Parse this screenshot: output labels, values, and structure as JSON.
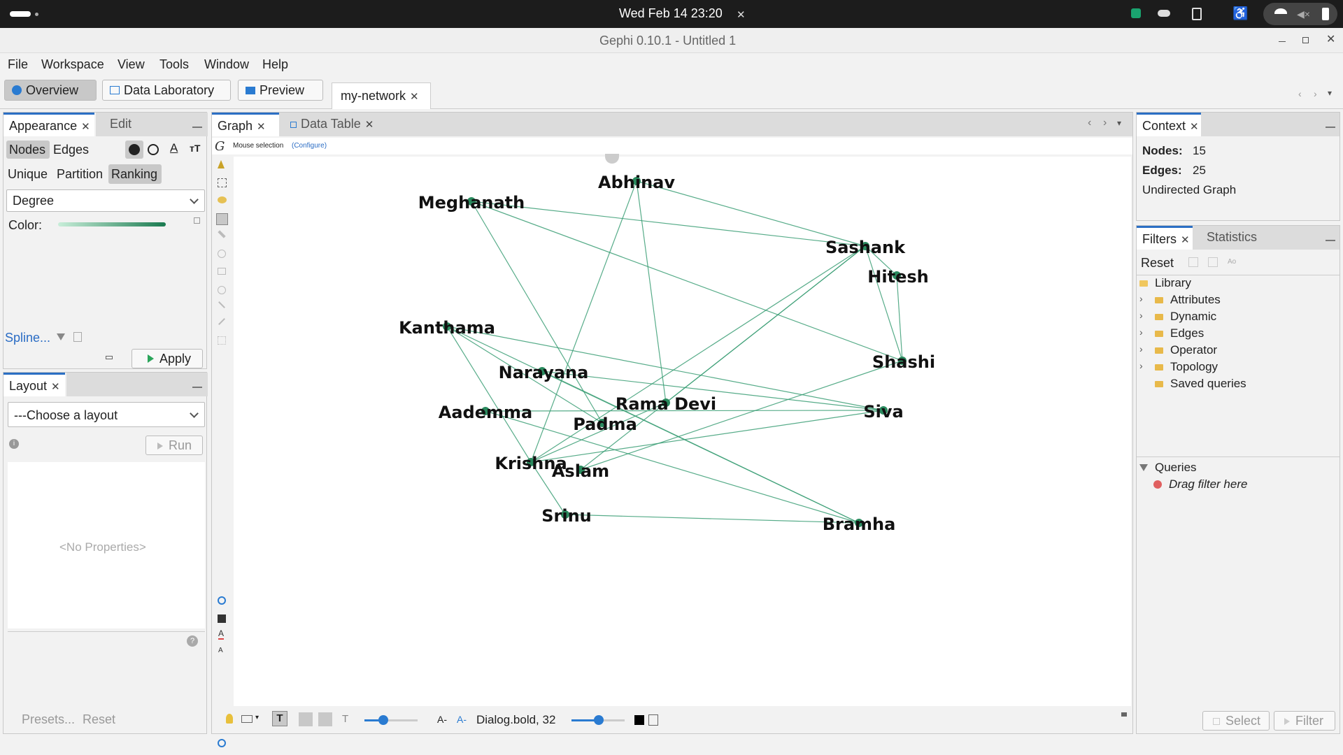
{
  "system": {
    "datetime": "Wed Feb 14  23:20"
  },
  "window": {
    "title": "Gephi 0.10.1 - Untitled 1"
  },
  "menu": [
    "File",
    "Workspace",
    "View",
    "Tools",
    "Window",
    "Help"
  ],
  "workspace": {
    "overview": "Overview",
    "data_lab": "Data Laboratory",
    "preview": "Preview",
    "project_tab": "my-network"
  },
  "appearance": {
    "tab": "Appearance",
    "edit_tab": "Edit",
    "nodes": "Nodes",
    "edges": "Edges",
    "unique": "Unique",
    "partition": "Partition",
    "ranking": "Ranking",
    "attribute": "Degree",
    "color_label": "Color:",
    "spline": "Spline...",
    "apply": "Apply"
  },
  "layout": {
    "tab": "Layout",
    "choose": "---Choose a layout",
    "run": "Run",
    "no_props": "<No Properties>",
    "presets": "Presets...",
    "reset": "Reset"
  },
  "graph": {
    "tab": "Graph",
    "data_table_tab": "Data Table",
    "mouse_selection": "Mouse selection",
    "configure": "(Configure)",
    "font": "Dialog.bold, 32"
  },
  "context": {
    "tab": "Context",
    "nodes_label": "Nodes:",
    "nodes_value": "15",
    "edges_label": "Edges:",
    "edges_value": "25",
    "graph_type": "Undirected Graph"
  },
  "filters": {
    "tab": "Filters",
    "statistics_tab": "Statistics",
    "reset": "Reset",
    "library": "Library",
    "items": [
      "Attributes",
      "Dynamic",
      "Edges",
      "Operator",
      "Topology",
      "Saved queries"
    ],
    "queries": "Queries",
    "drag_hint": "Drag filter here",
    "select": "Select",
    "filter": "Filter"
  },
  "network": {
    "nodes": [
      {
        "name": "Abhinav"
      },
      {
        "name": "Meghanath"
      },
      {
        "name": "Sashank"
      },
      {
        "name": "Hitesh"
      },
      {
        "name": "Kanthama"
      },
      {
        "name": "Narayana"
      },
      {
        "name": "Shashi"
      },
      {
        "name": "Aademma"
      },
      {
        "name": "Rama Devi"
      },
      {
        "name": "Siva"
      },
      {
        "name": "Padma"
      },
      {
        "name": "Krishna"
      },
      {
        "name": "Aslam"
      },
      {
        "name": "Srinu"
      },
      {
        "name": "Bramha"
      }
    ],
    "edges": [
      [
        "Abhinav",
        "Sashank"
      ],
      [
        "Abhinav",
        "Rama Devi"
      ],
      [
        "Abhinav",
        "Krishna"
      ],
      [
        "Meghanath",
        "Sashank"
      ],
      [
        "Meghanath",
        "Shashi"
      ],
      [
        "Meghanath",
        "Padma"
      ],
      [
        "Sashank",
        "Hitesh"
      ],
      [
        "Sashank",
        "Shashi"
      ],
      [
        "Sashank",
        "Rama Devi"
      ],
      [
        "Sashank",
        "Krishna"
      ],
      [
        "Sashank",
        "Aslam"
      ],
      [
        "Hitesh",
        "Shashi"
      ],
      [
        "Kanthama",
        "Krishna"
      ],
      [
        "Kanthama",
        "Bramha"
      ],
      [
        "Kanthama",
        "Siva"
      ],
      [
        "Kanthama",
        "Padma"
      ],
      [
        "Narayana",
        "Siva"
      ],
      [
        "Narayana",
        "Bramha"
      ],
      [
        "Shashi",
        "Aslam"
      ],
      [
        "Aademma",
        "Siva"
      ],
      [
        "Aademma",
        "Bramha"
      ],
      [
        "Rama Devi",
        "Krishna"
      ],
      [
        "Krishna",
        "Siva"
      ],
      [
        "Krishna",
        "Srinu"
      ],
      [
        "Srinu",
        "Bramha"
      ]
    ]
  }
}
